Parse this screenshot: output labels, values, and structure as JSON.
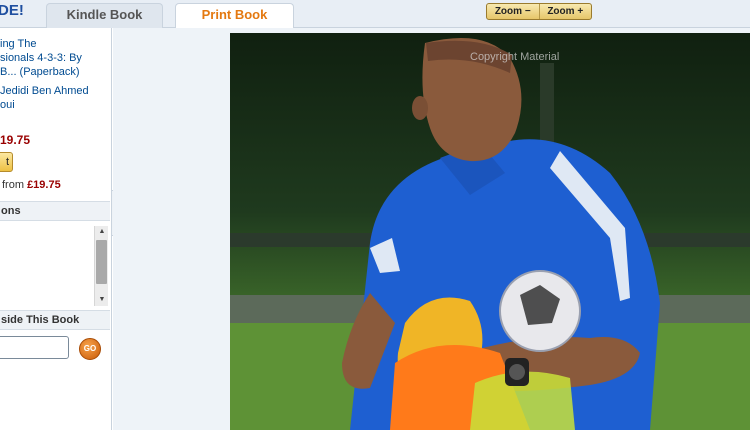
{
  "header": {
    "brand_fragment": "DE!",
    "tabs": [
      {
        "label": "Kindle Book",
        "active": false
      },
      {
        "label": "Print Book",
        "active": true
      }
    ],
    "zoom_out_label": "Zoom −",
    "zoom_in_label": "Zoom +"
  },
  "sidebar": {
    "book_title": "ing The\nsionals 4-3-3: By\nB... (Paperback)",
    "book_author": "Jedidi Ben Ahmed\noui",
    "price": "19.75",
    "buy_button_label": "t",
    "used_prefix": "from",
    "used_price": "£19.75",
    "editions_heading": "ons",
    "search_heading": "side This Book",
    "search_value": "",
    "go_button_label": "GO",
    "collapse_icon": "«"
  },
  "viewer": {
    "watermark": "Copyright  Material"
  },
  "colors": {
    "accent": "#e47911",
    "link": "#004b91",
    "price": "#990000"
  }
}
